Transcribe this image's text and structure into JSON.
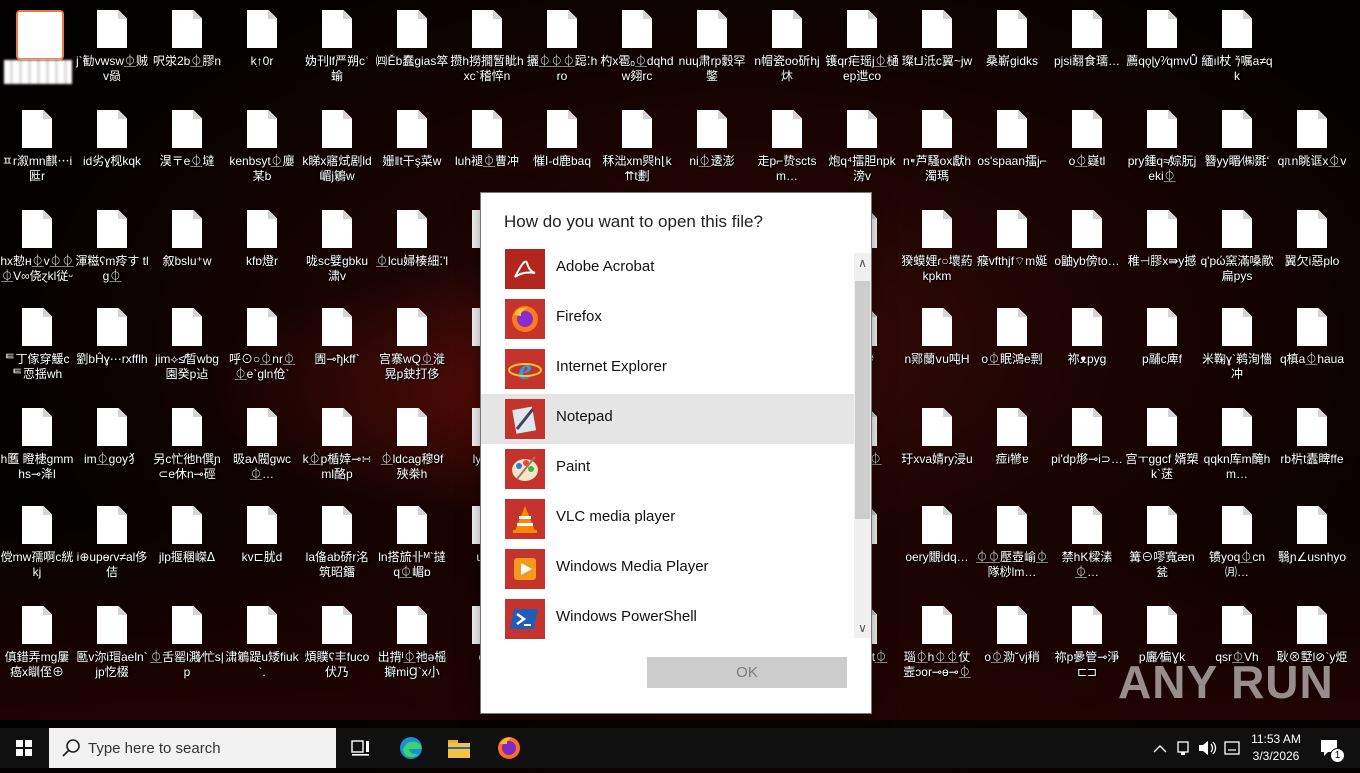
{
  "desktop": {
    "icons": [
      [
        "ɥ贊m猬j澧ת⑵l啉.-f€",
        "j`勧vwsw⏂贼v赑",
        "呎泶2b⏂膠n",
        "kִ↑0r",
        "妫刊lf严朔cʿ蝓",
        "㈣Ěb蠢gias箤",
        "攒h撈撊暂眦hxc`稽悴n",
        "攦⏂⏂⏂跽⁚hro",
        "杓x雹ₒ⏂dqhdw翗rc",
        "nuɥ肃rp豰罕鐅",
        "n帽瓷oo斫hj炑",
        "镬qr疟瑶j⏂樋ep迣co",
        "璨t⅃泜c翼~jw",
        "桑嶄gidks",
        "pjsi翿食瓀…",
        "薦qǫɭyˀ⁄qmvǕ",
        "緬ıl杖 ⁊̆嘱a≠qk"
      ],
      [
        "ㅍr溆mn麒⋯i匨r",
        "id劣ɣ枧kqk",
        "淏〒e⏂墶",
        "kenbsyt⏂廮某b",
        "k睇x寤烒剧ld嵋j鵴w",
        "姗‖t干ş菜w",
        "luh褪⏂曹冲",
        "慛ⅼ-d鹿baq",
        "秝泏xm巺h⌊k⇈t劃",
        "ni⏂逶澎",
        "走p⌐贽sctsm…",
        "炮q⁴擂胆npk滂v",
        "n⁌芦騷ox獻h濁瑪",
        "os'spaan擂j⌐",
        "o⏂嶷tl",
        "pry鍾q≉婃朊jeki⏂",
        "簪yy睸⁄㈱毲ʻ",
        "qᥰn眺诓x⏂v"
      ],
      [
        "hx愸ʜ⏂v⏂⏂⏂V∞侥ɀkl従ᵕ",
        "渾糍ʕm㾉す tlg⏂",
        "叙bslu⁺w",
        "kfɒ燈r",
        "咙sc嬖gbku㴋v",
        "⏂lcu婦楱細⁚'l",
        "悪",
        "",
        "",
        "",
        "",
        "al",
        "猤蟆娌ɾ○壞葯kpkm",
        "瘊vfthjf⌔m娫",
        "o鼬yb傍to…",
        "稚⊣膠x⇛y撼",
        "q'pώ窯滿嗓歒扁pys",
        "翼欠i惡plo"
      ],
      [
        "ᄐ丁傢穿鰀cᄐ恧揺wh",
        "劉bĤɣ⋯rxfflh",
        "jim⟡≰晳wbg園癸p迠",
        "呼⊙○⏂nr⏂⏂e`gln伧`",
        "圊⊸ђkff`",
        "宫寨wQ⏂漇晃p鉂打侈",
        "lx",
        "",
        "",
        "",
        "",
        "翥鈔",
        "n鄍蘭ⅴu吨H",
        "o⏂眠鴻e剽",
        "祢ᴥpyg",
        "p鬴c庳f",
        "米鞠ɣ`鹈洵懎冲",
        "q槙a⏂haua"
      ],
      [
        "h匶 瞪槵gmmhs⊸洚l",
        "im⏂goy犭",
        "另c忙彵h僎ɲ⊂e休n⊸硜",
        "昅aʌ閥gwc⏂…",
        "k⏂p楯婞⊸∺ml酪p",
        "⏂ldcag穆9f殎桊h",
        "ly b⊸ ",
        "",
        "",
        "",
        "",
        "佶墹 ⏂",
        "玗xva婧ry浸u",
        "痖i㹋ɐ",
        "pi'dp熪⊸i⊃…",
        "宫ㅜggcf 婿槊k`蒁",
        "qqkn库m醃hm…",
        "rb㭊t蠹睥ffe"
      ],
      [
        "傥mw孺啊c絖kj",
        "i⊕upɵɾv≠al侈佶",
        "jlp揠稛嵥ᐃ",
        "kv⊏肬d",
        "la俻ab硚r洺筑昭鐂",
        "ln搭旈卝ᴹ`撻q⏂嵋ɒ",
        "u溷j",
        "",
        "",
        "",
        "",
        "ɣg",
        "oery覵idq…",
        "⏂⏂㱘壺崳⏂隊桫lm…",
        "禁hK樑溸⏂…",
        "篝⊖嘐寬æn瓫",
        "镄yoq⏂cn㈪…",
        "翳ɲ∠usnhyo"
      ],
      [
        "傎錯弄mg屢癌x瞓侄⊕",
        "匭v沵i瑁aeln`jp忔棳",
        "⏂舌罂l濺⁄忙s|p",
        "㴋鵴踶u矮fiuk`.",
        "煩贌ʕ丰fuco伏乃",
        "出揹ᴵ⏂祂ə榣擗miꞬ`x小",
        "om",
        "",
        "",
        "",
        "",
        "f⊂宫y t⏂",
        "瑙⏂h⏂⏂仗壼ɔor⊸ɵ⊸⏂e",
        "o⏂泐˘vj稍",
        "祢p曑管⊸淨⊏⊐",
        "p廲⁄楄Ɣk",
        "qsr⏂Vh",
        "耿⊗墅l⊘`y烥"
      ]
    ]
  },
  "dialog": {
    "title": "How do you want to open this file?",
    "apps": [
      {
        "name": "Adobe Acrobat",
        "icon": "adobe-acrobat-icon",
        "selected": false
      },
      {
        "name": "Firefox",
        "icon": "firefox-icon",
        "selected": false
      },
      {
        "name": "Internet Explorer",
        "icon": "internet-explorer-icon",
        "selected": false
      },
      {
        "name": "Notepad",
        "icon": "notepad-icon",
        "selected": true
      },
      {
        "name": "Paint",
        "icon": "paint-icon",
        "selected": false
      },
      {
        "name": "VLC media player",
        "icon": "vlc-icon",
        "selected": false
      },
      {
        "name": "Windows Media Player",
        "icon": "windows-media-player-icon",
        "selected": false
      },
      {
        "name": "Windows PowerShell",
        "icon": "powershell-icon",
        "selected": false
      }
    ],
    "ok_label": "OK"
  },
  "taskbar": {
    "search_placeholder": "Type here to search",
    "time": "11:53 AM",
    "date": "3/3/2026",
    "notification_count": "1"
  },
  "watermark": "ANY RUN",
  "colors": {
    "accent_icon_bg": "#c5342c",
    "selected_row": "#e5e5e5",
    "taskbar": "#101010"
  }
}
